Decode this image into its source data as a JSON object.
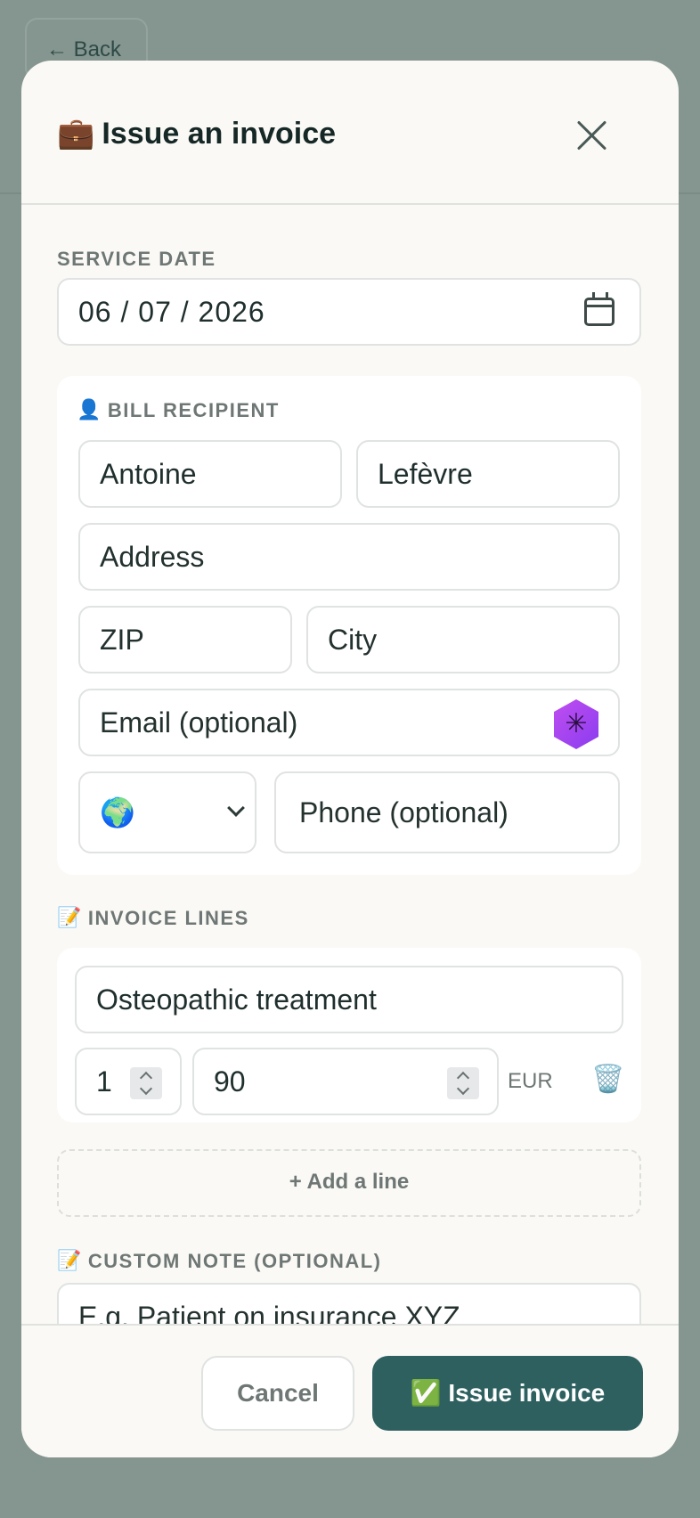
{
  "background": {
    "back_label": "← Back"
  },
  "modal": {
    "title": "Issue an invoice",
    "title_icon": "💼",
    "close_icon": "close-icon"
  },
  "service_date": {
    "label": "SERVICE DATE",
    "value": "06 / 07 / 2026"
  },
  "bill_recipient": {
    "label": "BILL RECIPIENT",
    "icon": "👤",
    "first_name": "Antoine",
    "last_name": "Lefèvre",
    "address_placeholder": "Address",
    "zip_placeholder": "ZIP",
    "city_placeholder": "City",
    "email_placeholder": "Email (optional)",
    "country_flag": "🌍",
    "phone_placeholder": "Phone (optional)"
  },
  "invoice_lines": {
    "label": "INVOICE LINES",
    "icon": "📝",
    "lines": [
      {
        "description": "Osteopathic treatment",
        "quantity": "1",
        "price": "90",
        "currency": "EUR",
        "delete_icon": "🗑️"
      }
    ],
    "add_line_label": "+ Add a line"
  },
  "custom_note": {
    "label": "CUSTOM NOTE (OPTIONAL)",
    "icon": "📝",
    "placeholder": "E.g. Patient on insurance XYZ"
  },
  "footer": {
    "cancel_label": "Cancel",
    "issue_label": "Issue invoice",
    "issue_icon": "✅"
  },
  "colors": {
    "primary": "#2e6060",
    "overlay": "#85958f",
    "modal_bg": "#faf9f5"
  }
}
